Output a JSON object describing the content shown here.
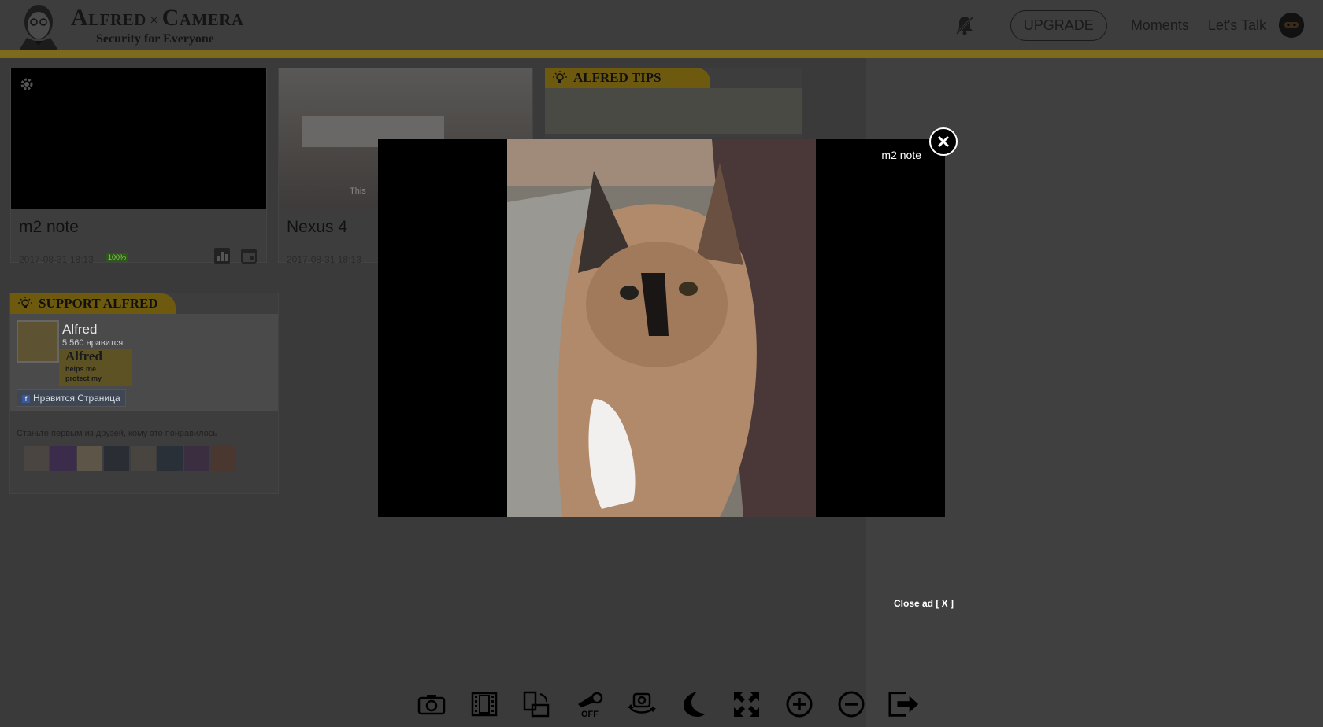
{
  "brand": {
    "title_left": "Alfred",
    "title_x": "×",
    "title_right": "Camera",
    "subtitle": "Security for Everyone"
  },
  "nav": {
    "upgrade": "UPGRADE",
    "moments": "Moments",
    "lets_talk": "Let's Talk"
  },
  "cameras": [
    {
      "name": "m2 note",
      "date": "2017-08-31 18:13",
      "battery": "100%"
    },
    {
      "name": "Nexus 4",
      "date": "2017-08-31 18:13",
      "overlay_text": "This"
    }
  ],
  "tips": {
    "title": "ALFRED TIPS"
  },
  "support": {
    "title": "SUPPORT ALFRED",
    "fb_name": "Alfred",
    "fb_likes": "5 560 нравится",
    "fb_like_button": "Нравится Страница",
    "fb_image_caption": "Alfred",
    "fb_image_text": "helps me protect my",
    "fb_friends_text": "Станьте первым из друзей, кому это понравилось"
  },
  "viewer": {
    "camera_name": "m2 note",
    "close_ad": "Close ad [ X ]"
  },
  "toolbar": {
    "flash_state": "OFF",
    "icons": [
      "camera-snapshot-icon",
      "record-video-icon",
      "rotate-screen-icon",
      "flashlight-icon",
      "switch-camera-icon",
      "night-mode-icon",
      "fullscreen-icon",
      "zoom-in-icon",
      "zoom-out-icon",
      "exit-icon"
    ]
  },
  "colors": {
    "accent": "#7d6a1c",
    "overlay_bg": "#3a3a3a",
    "battery": "#2b5a14"
  }
}
